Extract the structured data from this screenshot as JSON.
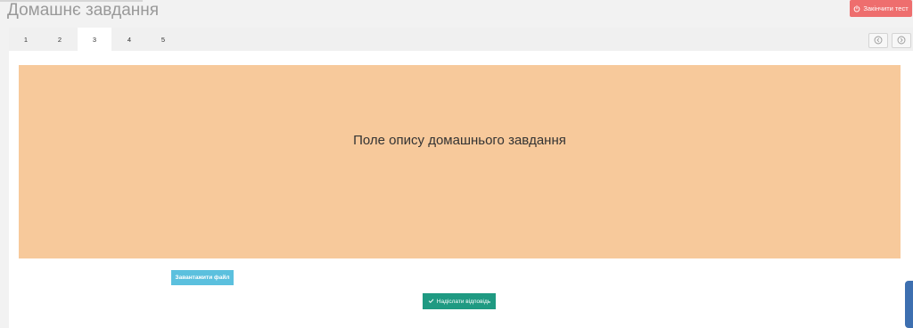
{
  "page": {
    "title": "Домашнє завдання"
  },
  "header": {
    "finish_label": "Закінчити тест",
    "finish_color": "#ee6e6e"
  },
  "tabs": [
    {
      "label": "1",
      "active": false
    },
    {
      "label": "2",
      "active": false
    },
    {
      "label": "3",
      "active": true
    },
    {
      "label": "4",
      "active": false
    },
    {
      "label": "5",
      "active": false
    }
  ],
  "nav": {
    "prev_icon": "chevron-left-circle-icon",
    "next_icon": "chevron-right-circle-icon"
  },
  "task": {
    "description": "Поле опису домашнього завдання",
    "box_color": "#f7c99b"
  },
  "actions": {
    "upload_label": "Завантажити файл",
    "upload_color": "#5bc0de",
    "submit_label": "Надіслати відповідь",
    "submit_color": "#1f9a82"
  }
}
